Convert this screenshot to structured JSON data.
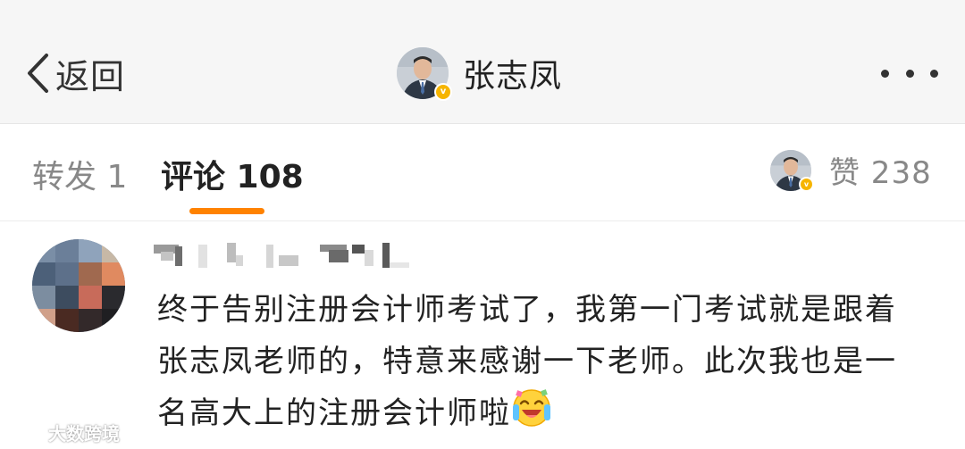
{
  "nav": {
    "back_label": "返回",
    "title": "张志凤",
    "back_icon": "chevron-left-icon",
    "more_icon": "more-dots-icon"
  },
  "tabs": {
    "repost_label": "转发 1",
    "comment_label": "评论 108",
    "likes_label": "赞 238"
  },
  "comment": {
    "text": "终于告别注册会计师考试了，我第一门考试就是跟着张志凤老师的，特意来感谢一下老师。此次我也是一名高大上的注册会计师啦",
    "emoji": "laughing-crying-emoji"
  },
  "watermark": {
    "text": "大数跨境"
  },
  "colors": {
    "accent": "#ff8200",
    "verified": "#f6b500",
    "topbar_bg": "#f6f6f6"
  }
}
